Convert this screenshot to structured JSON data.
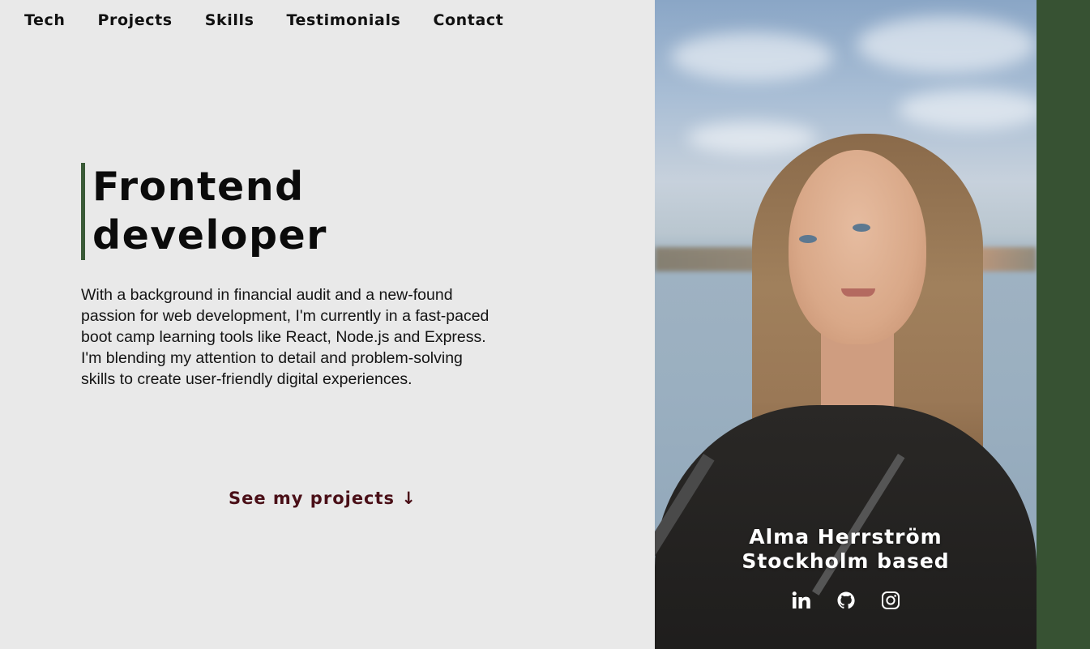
{
  "nav": {
    "items": [
      {
        "label": "Tech"
      },
      {
        "label": "Projects"
      },
      {
        "label": "Skills"
      },
      {
        "label": "Testimonials"
      },
      {
        "label": "Contact"
      }
    ]
  },
  "hero": {
    "title": "Frontend\ndeveloper",
    "intro": "With a background in financial audit and a new-found passion for web development, I'm currently in a fast-paced boot camp learning tools like React, Node.js and Express. I'm blending my attention to detail and problem-solving skills to create user-friendly digital experiences.",
    "cta_label": "See my projects ↓"
  },
  "profile": {
    "name": "Alma Herrström",
    "location": "Stockholm based",
    "socials": [
      {
        "icon": "linkedin-icon"
      },
      {
        "icon": "github-icon"
      },
      {
        "icon": "instagram-icon"
      }
    ]
  },
  "colors": {
    "background": "#e9e9e9",
    "accent_green": "#375233",
    "title_bar": "#3a5a37",
    "cta": "#4a0f17"
  }
}
